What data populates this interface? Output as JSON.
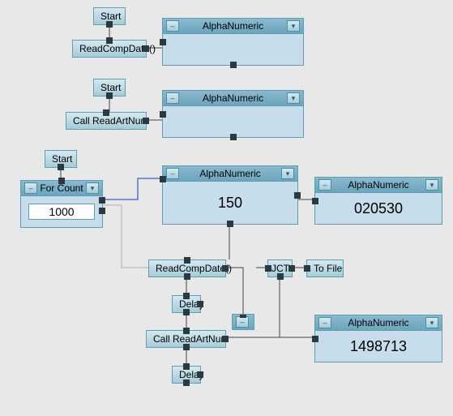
{
  "nodes": {
    "start1": {
      "label": "Start"
    },
    "start2": {
      "label": "Start"
    },
    "start3": {
      "label": "Start"
    },
    "readCompDate1": {
      "label": "ReadCompDate()"
    },
    "readCompDate2": {
      "label": "ReadCompDate()"
    },
    "callReadArtNum1": {
      "label": "Call ReadArtNum"
    },
    "callReadArtNum2": {
      "label": "Call ReadArtNum"
    },
    "delay1": {
      "label": "Delay"
    },
    "delay2": {
      "label": "Delay"
    },
    "jct": {
      "label": "JCT"
    },
    "toFile": {
      "label": "To File"
    }
  },
  "panels": {
    "alpha1": {
      "title": "AlphaNumeric",
      "value": ""
    },
    "alpha2": {
      "title": "AlphaNumeric",
      "value": ""
    },
    "forCount": {
      "title": "For Count",
      "input": "1000"
    },
    "alpha3": {
      "title": "AlphaNumeric",
      "value": "150"
    },
    "alpha4": {
      "title": "AlphaNumeric",
      "value": "020530"
    },
    "alpha5": {
      "title": "AlphaNumeric",
      "value": "1498713"
    }
  }
}
